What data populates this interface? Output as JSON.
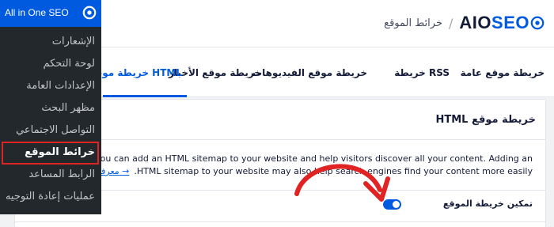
{
  "header": {
    "logo_primary": "AIO",
    "logo_accent": "SEO",
    "separator": "/",
    "page_title": "خرائط الموقع"
  },
  "tabs": [
    {
      "label": "خريطة موقع عامة",
      "active": false
    },
    {
      "label": "خريطة RSS",
      "active": false
    },
    {
      "label": "خريطة موقع الفيديوهات",
      "active": false
    },
    {
      "label": "خريطة موقع الأخبار",
      "active": false
    },
    {
      "label": "خريطة موقع HTML",
      "active": true
    }
  ],
  "card": {
    "title": "خريطة موقع HTML",
    "description_line1": "ilt tools below, you can add an HTML sitemap to your website and help visitors discover all your content. Adding an",
    "description_line2": ".HTML sitemap to your website may also help search engines find your content more easily",
    "learn_more": "معرفة المزيد →",
    "toggle_label": "تمكين خريطة الموقع",
    "toggle_on": true
  },
  "sidebar": {
    "title": "All in One SEO",
    "items": [
      {
        "label": "الإشعارات",
        "active": false
      },
      {
        "label": "لوحة التحكم",
        "active": false
      },
      {
        "label": "الإعدادات العامة",
        "active": false
      },
      {
        "label": "مظهر البحث",
        "active": false
      },
      {
        "label": "التواصل الاجتماعي",
        "active": false
      },
      {
        "label": "خرائط الموقع",
        "active": true
      },
      {
        "label": "الرابط المساعد",
        "active": false
      },
      {
        "label": "عمليات إعادة التوجيه",
        "active": false
      }
    ]
  },
  "colors": {
    "accent": "#005ae0",
    "sidebar_bg": "#23282d",
    "highlight": "#e02424"
  }
}
